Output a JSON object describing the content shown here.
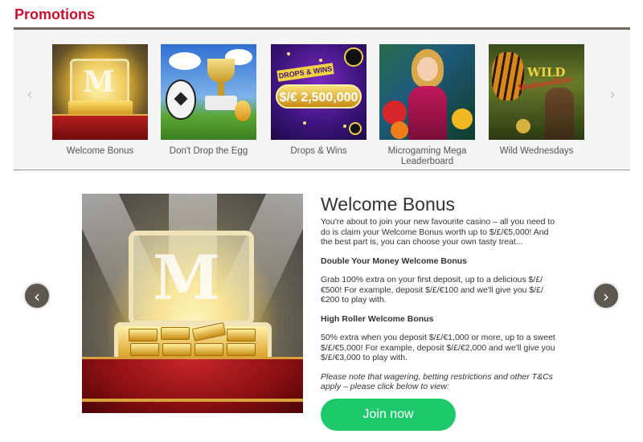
{
  "header": {
    "title": "Promotions",
    "accent_color": "#c8102e"
  },
  "carousel": {
    "prev_icon": "‹",
    "next_icon": "›",
    "items": [
      {
        "label": "Welcome Bonus"
      },
      {
        "label": "Don't Drop the Egg"
      },
      {
        "label": "Drops & Wins",
        "art_banner": "DROPS & WINS",
        "art_amount": "$/€ 2,500,000"
      },
      {
        "label": "Microgaming Mega Leaderboard"
      },
      {
        "label": "Wild Wednesdays",
        "art_title": "WILD",
        "art_subtitle": "Wednesdays"
      }
    ]
  },
  "detail": {
    "title": "Welcome Bonus",
    "intro": "You're about to join your new favourite casino – all you need to do is claim your Welcome Bonus worth up to $/£/€5,000! And the best part is, you can choose your own tasty treat...",
    "section1_heading": "Double Your Money Welcome Bonus",
    "section1_body": "Grab 100% extra on your first deposit, up to a delicious $/£/€500! For example, deposit $/£/€100 and we'll give you $/£/€200 to play with.",
    "section2_heading": "High Roller Welcome Bonus",
    "section2_body": "50% extra when you deposit $/£/€1,000 or more, up to a sweet $/£/€5,000! For example, deposit $/£/€2,000 and we'll give you $/£/€3,000 to play with.",
    "note": "Please note that wagering, betting restrictions and other T&Cs apply – please click below to view:",
    "cta_label": "Join now",
    "cta_color": "#1ec96b",
    "prev_icon": "‹",
    "next_icon": "›"
  }
}
